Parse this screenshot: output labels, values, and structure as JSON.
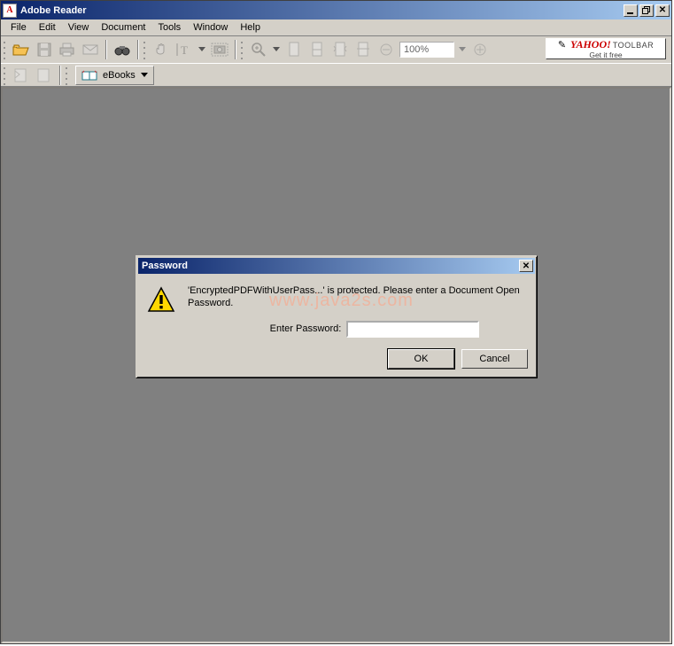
{
  "app": {
    "title": "Adobe Reader",
    "icon_letter": "A"
  },
  "win_controls": {
    "min": "_",
    "restore": "❐",
    "close": "✕"
  },
  "menu": [
    "File",
    "Edit",
    "View",
    "Document",
    "Tools",
    "Window",
    "Help"
  ],
  "zoom": {
    "value": "100%"
  },
  "yahoo": {
    "logo": "YAHOO!",
    "word": "TOOLBAR",
    "sub": "Get it free"
  },
  "ebooks": {
    "label": "eBooks"
  },
  "dialog": {
    "title": "Password",
    "message": "'EncryptedPDFWithUserPass...' is protected.  Please enter a Document Open Password.",
    "field_label": "Enter Password:",
    "ok": "OK",
    "cancel": "Cancel",
    "close": "✕"
  },
  "watermark": "www.java2s.com",
  "icons": {
    "open": "open-folder",
    "save": "diskette",
    "print": "printer",
    "mail": "envelope",
    "find": "binoculars",
    "hand": "hand",
    "text_select": "text-select",
    "snapshot": "camera",
    "zoom": "magnifier",
    "page": "page",
    "fit": "fit-page",
    "minus": "minus-circle",
    "plus": "plus-circle",
    "ebook": "ebook"
  }
}
